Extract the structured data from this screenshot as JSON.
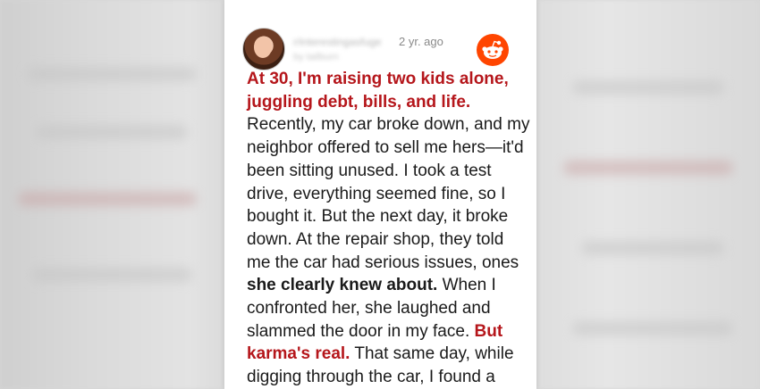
{
  "post": {
    "time_ago": "2 yr. ago",
    "username_blurred": "r/interestingasfuge",
    "byline_blurred": "by tailburn",
    "headline": "At 30, I'm raising two kids alone, juggling debt, bills, and life.",
    "body_1": " Recently, my car broke down, and my neighbor offered to sell me hers—it'd been sitting unused. I took a test drive, everything seemed fine, so I bought it. But the next day, it broke down. At the repair shop, they told me the car had serious issues, ones ",
    "bold_1": "she clearly knew about.",
    "body_2": " When I confronted her, she laughed and slammed the door in my face. ",
    "highlight_2": "But karma's real.",
    "body_3": " That same day, while digging through the car, I found a"
  },
  "icons": {
    "avatar": "user-avatar",
    "platform": "reddit-logo-icon"
  },
  "colors": {
    "highlight": "#b5161b",
    "reddit": "#ff4500"
  }
}
